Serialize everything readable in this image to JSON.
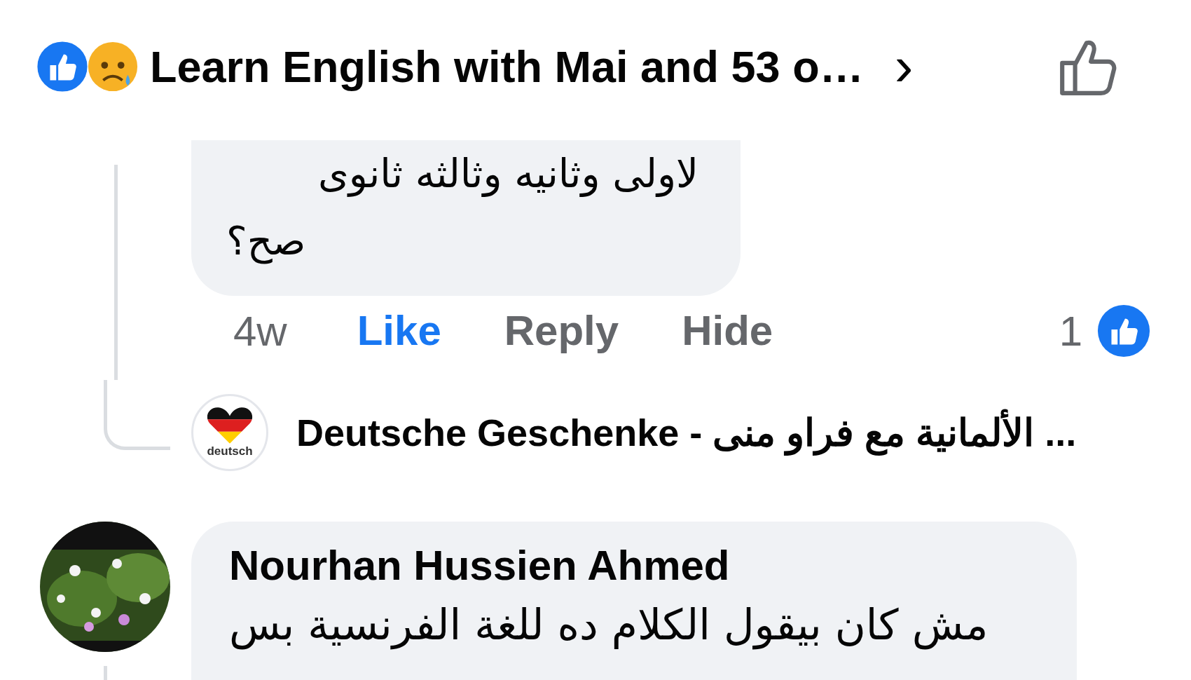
{
  "header": {
    "title": "Learn English with Mai and 53 o…",
    "chevron": "›"
  },
  "comment": {
    "lines": [
      "لاولى وثانيه وثالثه ثانوى",
      "صح؟"
    ],
    "time": "4w",
    "like_action": {
      "label": "Like",
      "liked": true
    },
    "reply_action": {
      "label": "Reply"
    },
    "hide_action": {
      "label": "Hide"
    },
    "reaction_count": "1"
  },
  "reply_preview": {
    "avatar_label": "deutsch",
    "author": "Deutsche Geschenke - الألمانية مع فراو منى ..."
  },
  "next_comment": {
    "author": "Nourhan Hussien Ahmed",
    "text": "مش كان بيقول  الكلام ده للغة الفرنسية بس"
  }
}
